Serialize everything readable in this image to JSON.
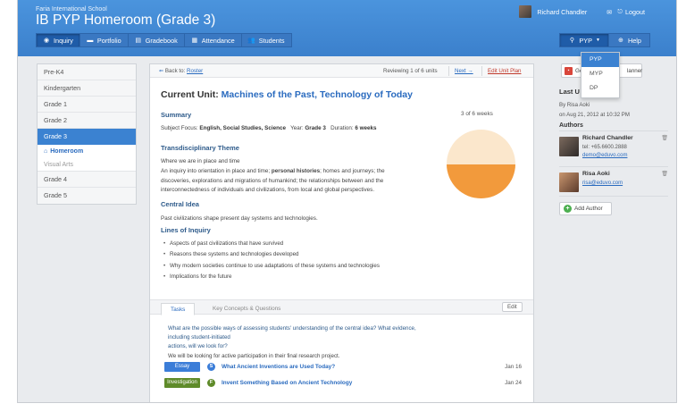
{
  "header": {
    "school": "Faria International School",
    "title": "IB PYP Homeroom (Grade 3)",
    "user_name": "Richard Chandler",
    "logout": "Logout"
  },
  "nav": {
    "items": [
      {
        "label": "Inquiry",
        "icon": "compass-icon"
      },
      {
        "label": "Portfolio",
        "icon": "briefcase-icon"
      },
      {
        "label": "Gradebook",
        "icon": "gradebook-icon"
      },
      {
        "label": "Attendance",
        "icon": "calendar-icon"
      },
      {
        "label": "Students",
        "icon": "users-icon"
      }
    ],
    "program": "PYP",
    "help": "Help"
  },
  "program_menu": [
    "PYP",
    "MYP",
    "DP"
  ],
  "sidebar": {
    "items": [
      "Pre-K4",
      "Kindergarten",
      "Grade 1",
      "Grade 2",
      "Grade 3"
    ],
    "sub_active": "Homeroom",
    "sub_other": "Visual Arts",
    "items_after": [
      "Grade 4",
      "Grade 5"
    ]
  },
  "topbar": {
    "back_label": "Back to:",
    "back_link": "Roster",
    "reviewing": "Reviewing 1 of 6 units",
    "next": "Next →",
    "edit_plan": "Edit Unit Plan"
  },
  "unit": {
    "prefix": "Current Unit:",
    "name": "Machines of the Past, Technology of Today",
    "summary_heading": "Summary",
    "subject_label": "Subject Focus:",
    "subject_value": "English, Social Studies, Science",
    "year_label": "Year:",
    "year_value": "Grade 3",
    "duration_label": "Duration:",
    "duration_value": "6 weeks",
    "weeks_progress": "3 of 6 weeks",
    "weeks_done": 3,
    "weeks_total": 6,
    "theme_heading": "Transdisciplinary Theme",
    "theme_title": "Where we are in place and time",
    "theme_line1_a": "An inquiry into orientation in place and time;",
    "theme_line1_b": "personal histories",
    "theme_line1_c": "; homes and journeys; the",
    "theme_line2": "discoveries, explorations and migrations of humankind; the relationships between and the",
    "theme_line3": "interconnectedness of individuals and civilizations, from local and global perspectives.",
    "central_heading": "Central Idea",
    "central_text": "Past civilizations shape present day systems and technologies.",
    "lines_heading": "Lines of Inquiry",
    "lines": [
      "Aspects of past civilizations that have survived",
      "Reasons these systems and technologies developed",
      "Why modern societies continue to use adaptations of these systems and technologies",
      "Implications for the future"
    ]
  },
  "tabs": {
    "tasks": "Tasks",
    "concepts": "Key Concepts & Questions",
    "edit": "Edit",
    "question1": "What are the possible ways of assessing students' understanding of the central idea? What evidence, including student-initiated",
    "question2": "actions, will we look for?",
    "answer": "We will be looking for active participation in their final research project.",
    "rows": [
      {
        "tag": "Essay",
        "tag_color": "#3b7dd8",
        "letter": "S",
        "letter_color": "#3b7dd8",
        "title": "What Ancient Inventions are Used Today?",
        "date": "Jan 16"
      },
      {
        "tag": "Investigation",
        "tag_color": "#5f8b2a",
        "letter": "F",
        "letter_color": "#5f8b2a",
        "title": "Invent Something Based on Ancient Technology",
        "date": "Jan 24"
      }
    ]
  },
  "right": {
    "gen_left": "Ge",
    "gen_right": "lanner",
    "last_label": "Last U",
    "by": "By Risa Aoki",
    "on": "on Aug 21, 2012 at 10:32 PM",
    "authors_heading": "Authors",
    "authors": [
      {
        "name": "Richard Chandler",
        "phone": "tel: +65.6600.2888",
        "email": "demo@eduvo.com"
      },
      {
        "name": "Risa Aoki",
        "email": "risa@eduvo.com"
      }
    ],
    "add_author": "Add Author"
  },
  "colors": {
    "accent": "#3b82d1",
    "header": "#4189d6",
    "pie_fill": "#f29a3c",
    "pie_bg": "#fbe7cc"
  }
}
